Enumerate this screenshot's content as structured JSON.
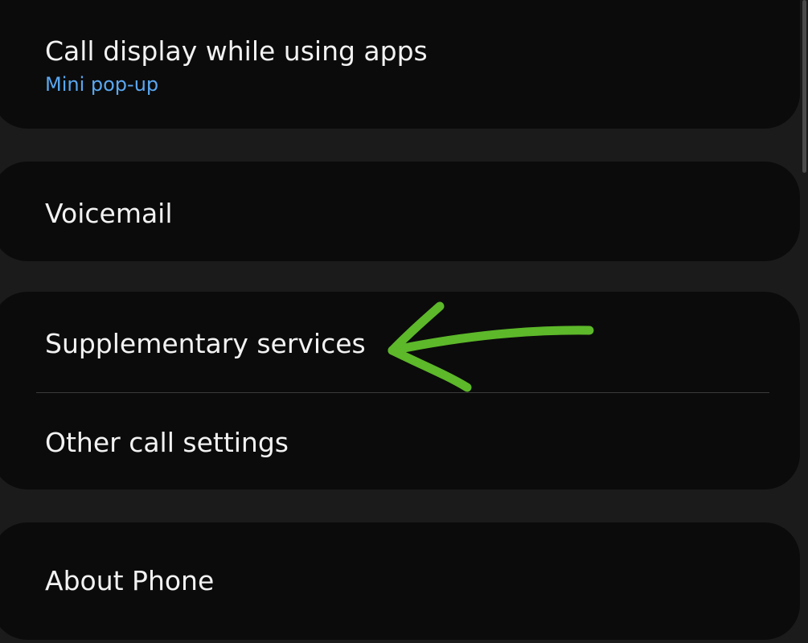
{
  "settings": {
    "call_display": {
      "title": "Call display while using apps",
      "subtitle": "Mini pop-up"
    },
    "voicemail": {
      "title": "Voicemail"
    },
    "supplementary_services": {
      "title": "Supplementary services"
    },
    "other_call_settings": {
      "title": "Other call settings"
    },
    "about_phone": {
      "title": "About Phone"
    }
  },
  "annotation": {
    "arrow_color": "#5db82a",
    "icon": "arrow-left-annotation"
  },
  "colors": {
    "background": "#1b1b1b",
    "card": "#0b0b0b",
    "text": "#f2f2f2",
    "accent": "#5aa7f0"
  }
}
